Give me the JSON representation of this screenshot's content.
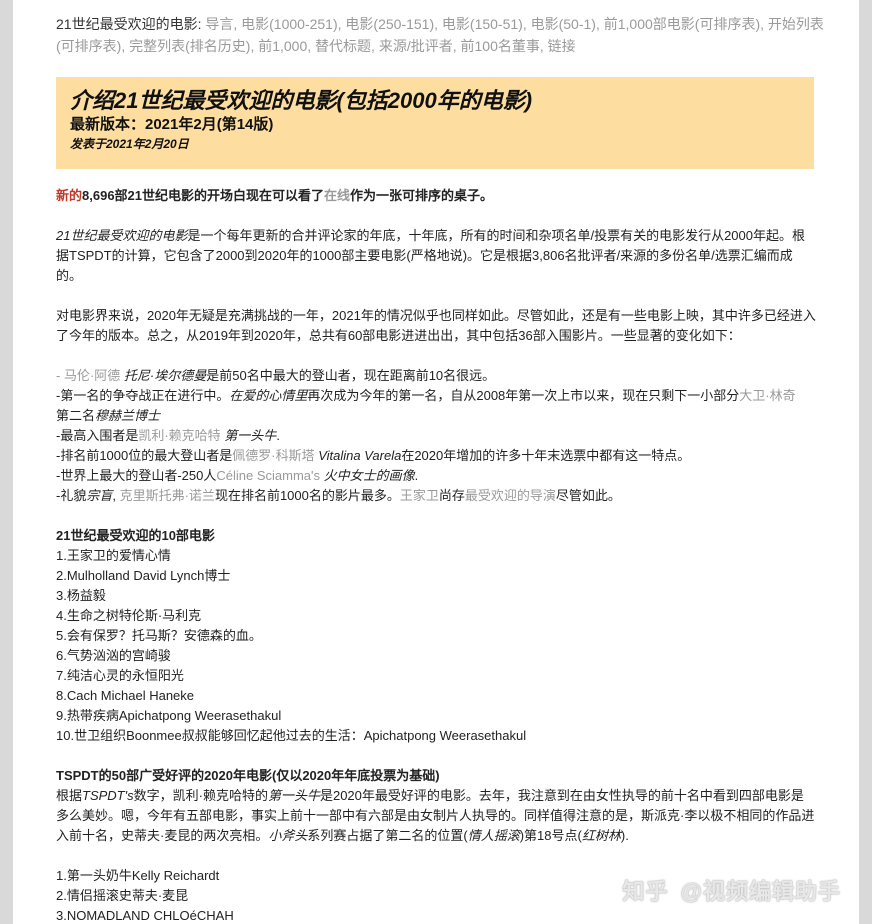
{
  "nav": {
    "label": "21世纪最受欢迎的电影:",
    "links": [
      "导言",
      "电影(1000-251)",
      "电影(250-151)",
      "电影(150-51)",
      "电影(50-1)",
      "前1,000部电影(可排序表)",
      "开始列表(可排序表)",
      "完整列表(排名历史)",
      "前1,000",
      "替代标题",
      "来源/批评者",
      "前100名董事",
      "链接"
    ]
  },
  "banner": {
    "title": "介绍21世纪最受欢迎的电影(包括2000年的电影)",
    "version": "最新版本：2021年2月(第14版)",
    "published": "发表于2021年2月20日"
  },
  "intro": {
    "new": "新的",
    "line1a": "8,696部21世纪电影的开场白现在可以看了",
    "online": "在线",
    "line1b": "作为一张可排序的桌子。"
  },
  "p2": {
    "italic": "21世纪最受欢迎的电影",
    "text": "是一个每年更新的合并评论家的年底，十年底，所有的时间和杂项名单/投票有关的电影发行从2000年起。根据TSPDT的计算，它包含了2000到2020年的1000部主要电影(严格地说)。它是根据3,806名批评者/来源的多份名单/选票汇编而成的。"
  },
  "p3": {
    "text": "对电影界来说，2020年无疑是充满挑战的一年，2021年的情况似乎也同样如此。尽管如此，还是有一些电影上映，其中许多已经进入了今年的版本。总之，从2019年到2020年，总共有60部电影进进出出，其中包括36部入围影片。一些显著的变化如下："
  },
  "changes": {
    "c1a": "- 马伦·阿德 ",
    "c1b": "托尼·埃尔德曼",
    "c1c": "是前50名中最大的登山者，现在距离前10名很远。",
    "c2a": "-第一名的争夺战正在进行中。",
    "c2b": "在爱的心情里",
    "c2c": "再次成为今年的第一名，自从2008年第一次上市以来，现在只剩下一小部分",
    "c2d": "大卫·林奇",
    "c2e": "第二名",
    "c2f": "穆赫兰博士",
    "c3a": "-最高入围者是",
    "c3b": "凯利·赖克哈特",
    "c3c": " 第一头牛",
    "c3d": ".",
    "c4a": "-排名前1000位的最大登山者是",
    "c4b": "佩德罗·科斯塔",
    "c4c": " Vitalina Varela",
    "c4d": "在2020年增加的许多十年末选票中都有这一特点。",
    "c5a": "-世界上最大的登山者-250人",
    "c5b": "Céline Sciamma's",
    "c5c": " 火中女士的画像",
    "c5d": ".",
    "c6a": "-礼貌",
    "c6b": "宗盲",
    "c6c": ", ",
    "c6d": "克里斯托弗·诺兰",
    "c6e": "现在排名前1000名的影片最多。",
    "c6f": "王家卫",
    "c6g": "尚存",
    "c6h": "最受欢迎的导演",
    "c6i": "尽管如此。"
  },
  "top10": {
    "heading": "21世纪最受欢迎的10部电影",
    "items": [
      "1.王家卫的爱情心情",
      "2.Mulholland David Lynch博士",
      "3.杨益毅",
      "4.生命之树特伦斯·马利克",
      "5.会有保罗？托马斯？安德森的血。",
      "6.气势汹汹的宫崎骏",
      "7.纯洁心灵的永恒阳光",
      "8.Cach Michael Haneke",
      "9.热带疾病Apichatpong Weerasethakul",
      "10.世卫组织Boonmee叔叔能够回忆起他过去的生活：Apichatpong Weerasethakul"
    ]
  },
  "tspdt": {
    "heading": "TSPDT的50部广受好评的2020年电影(仅以2020年年底投票为基础)",
    "t1": "根据",
    "t2": "TSPDT's",
    "t3": "数字，凯利·赖克哈特的",
    "t4": "第一头牛",
    "t5": "是2020年最受好评的电影。去年，我注意到在由女性执导的前十名中看到四部电影是多么美妙。嗯，今年有五部电影，事实上前十一部中有六部是由女制片人执导的。同样值得注意的是，斯派克·李以极不相同的作品进入前十名，史蒂夫·麦昆的两次亮相。",
    "t6": "小斧头",
    "t7": "系列赛占据了第二名的位置(",
    "t8": "情人摇滚",
    "t9": ")第18号点(",
    "t10": "红树林",
    "t11": ").",
    "items": [
      "1.第一头奶牛Kelly Reichardt",
      "2.情侣摇滚史蒂夫·麦昆",
      "3.NOMADLAND CHLOéCHAH"
    ]
  },
  "watermark": {
    "left": "知乎",
    "right": "@视频编辑助手"
  }
}
